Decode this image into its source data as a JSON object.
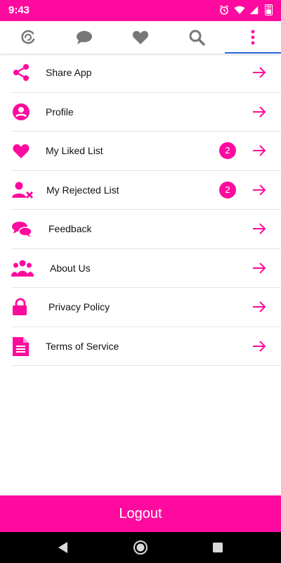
{
  "status_bar": {
    "time": "9:43",
    "battery_level": "96",
    "icons": [
      "alarm-icon",
      "wifi-icon",
      "signal-icon",
      "battery-icon"
    ]
  },
  "tabs": [
    {
      "icon": "logo-g-icon",
      "active": false
    },
    {
      "icon": "chat-bubble-icon",
      "active": false
    },
    {
      "icon": "heart-icon",
      "active": false
    },
    {
      "icon": "search-icon",
      "active": false
    },
    {
      "icon": "more-vertical-icon",
      "active": true
    }
  ],
  "menu": {
    "items": [
      {
        "label": "Share App",
        "icon": "share-icon",
        "badge": ""
      },
      {
        "label": "Profile",
        "icon": "profile-icon",
        "badge": ""
      },
      {
        "label": "My Liked List",
        "icon": "heart-icon",
        "badge": "2"
      },
      {
        "label": "My Rejected List",
        "icon": "user-reject-icon",
        "badge": "2"
      },
      {
        "label": "Feedback",
        "icon": "feedback-icon",
        "badge": ""
      },
      {
        "label": "About Us",
        "icon": "group-icon",
        "badge": ""
      },
      {
        "label": "Privacy Policy",
        "icon": "lock-icon",
        "badge": ""
      },
      {
        "label": "Terms of Service",
        "icon": "document-icon",
        "badge": ""
      }
    ]
  },
  "logout_label": "Logout",
  "colors": {
    "accent": "#ff0a9e",
    "tab_indicator": "#2b6de0",
    "tab_icon": "#777777"
  }
}
